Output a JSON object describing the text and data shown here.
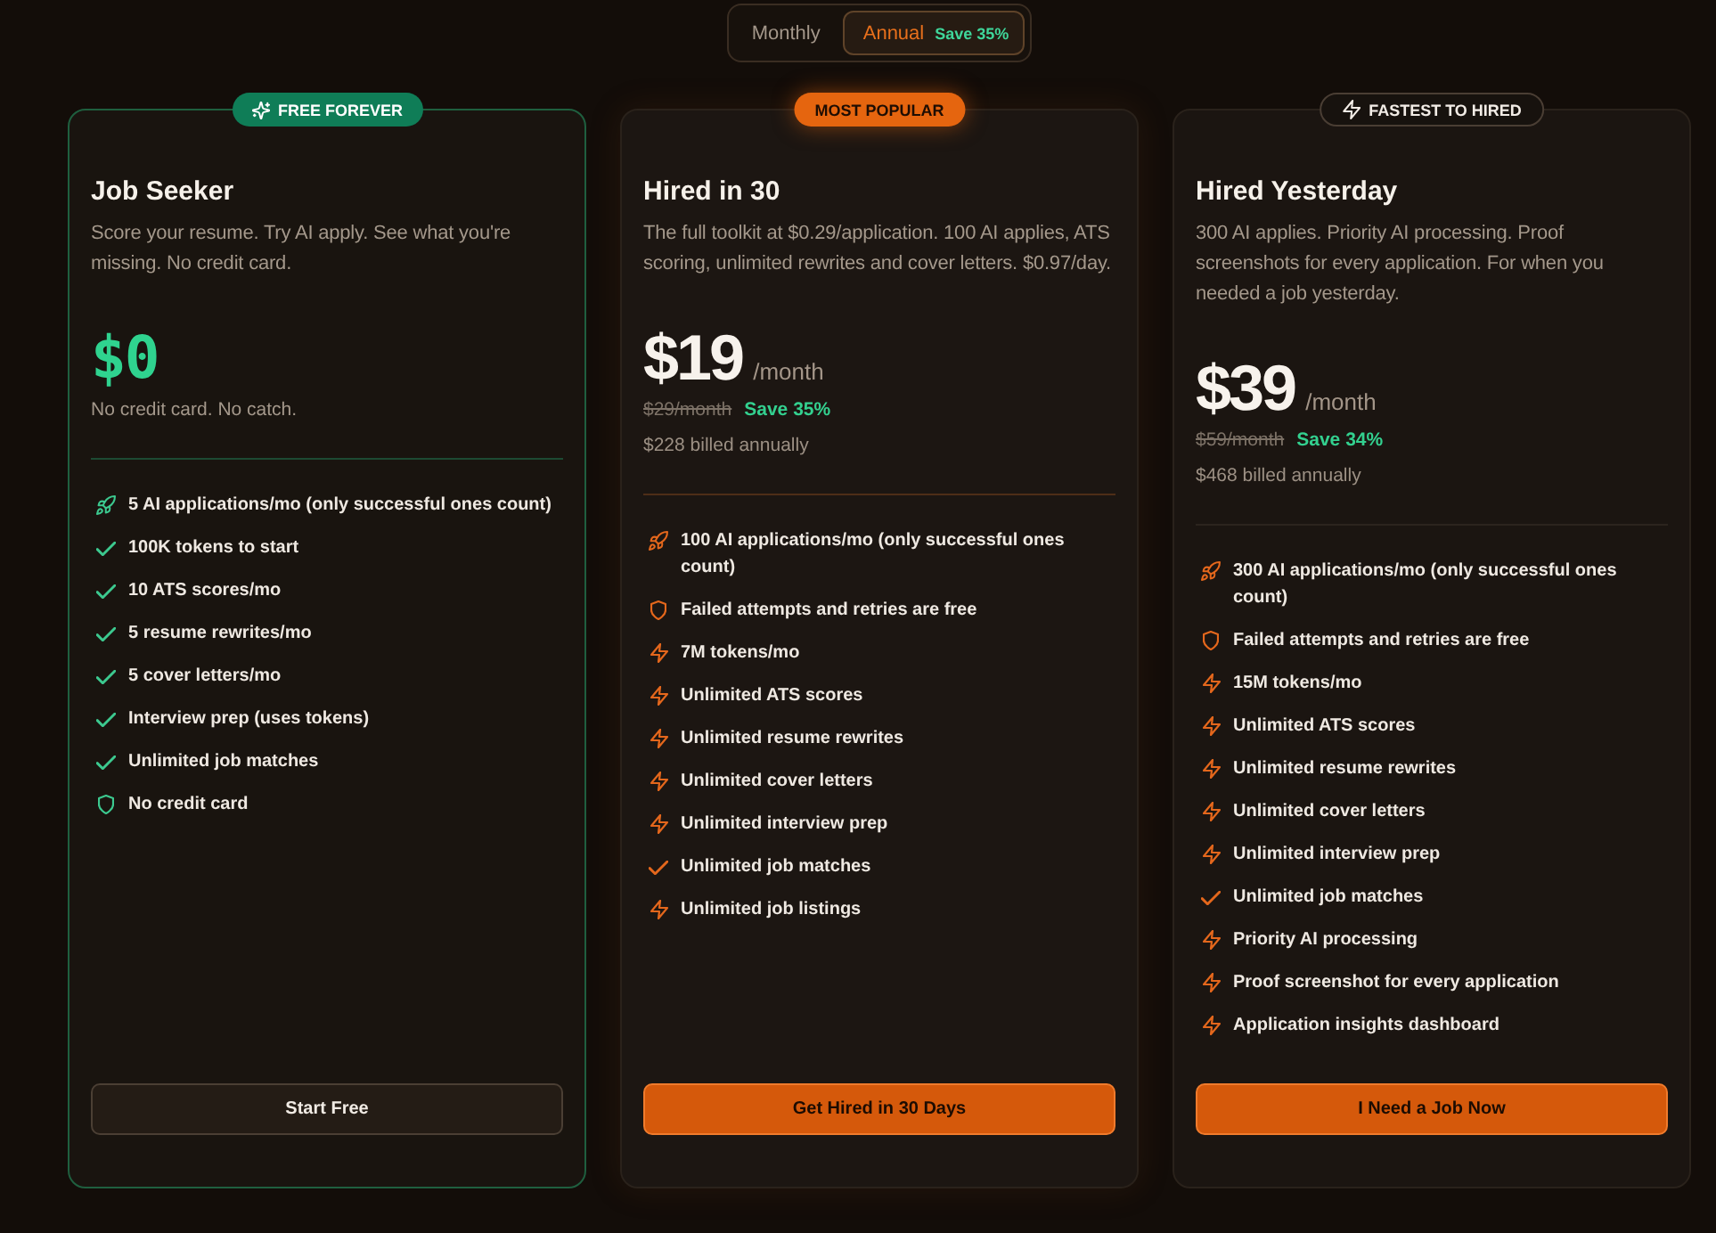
{
  "billing_toggle": {
    "options": [
      {
        "label": "Monthly",
        "selected": false
      },
      {
        "label": "Annual",
        "selected": true,
        "badge": "Save 35%"
      }
    ]
  },
  "plans": [
    {
      "kind": "free",
      "badge": "FREE FOREVER",
      "name": "Job Seeker",
      "description": "Score your resume. Try AI apply. See what you're missing. No credit card.",
      "price": "$0",
      "note": "No credit card. No catch.",
      "features": [
        {
          "kind": "applications",
          "text": "5 AI applications/mo (only successful ones count)"
        },
        {
          "kind": "included",
          "text": "100K tokens to start"
        },
        {
          "kind": "included",
          "text": "10 ATS scores/mo"
        },
        {
          "kind": "included",
          "text": "5 resume rewrites/mo"
        },
        {
          "kind": "included",
          "text": "5 cover letters/mo"
        },
        {
          "kind": "included",
          "text": "Interview prep (uses tokens)"
        },
        {
          "kind": "included",
          "text": "Unlimited job matches"
        },
        {
          "kind": "guarantee",
          "text": "No credit card"
        }
      ],
      "button": "Start Free"
    },
    {
      "kind": "popular",
      "badge": "MOST POPULAR",
      "name": "Hired in 30",
      "description": "The full toolkit at $0.29/application. 100 AI applies, ATS scoring, unlimited rewrites and cover letters. $0.97/day.",
      "price": "$19",
      "period": "/month",
      "original_price": "$29/month",
      "savings": "Save 35%",
      "billing": "$228 billed annually",
      "features": [
        {
          "kind": "applications",
          "text": "100 AI applications/mo (only successful ones count)"
        },
        {
          "kind": "guarantee",
          "text": "Failed attempts and retries are free"
        },
        {
          "kind": "boost",
          "text": "7M tokens/mo"
        },
        {
          "kind": "boost",
          "text": "Unlimited ATS scores"
        },
        {
          "kind": "boost",
          "text": "Unlimited resume rewrites"
        },
        {
          "kind": "boost",
          "text": "Unlimited cover letters"
        },
        {
          "kind": "boost",
          "text": "Unlimited interview prep"
        },
        {
          "kind": "included",
          "text": "Unlimited job matches"
        },
        {
          "kind": "boost",
          "text": "Unlimited job listings"
        }
      ],
      "button": "Get Hired in 30 Days"
    },
    {
      "kind": "premium",
      "badge": "FASTEST TO HIRED",
      "name": "Hired Yesterday",
      "description": "300 AI applies. Priority AI processing. Proof screenshots for every application. For when you needed a job yesterday.",
      "price": "$39",
      "period": "/month",
      "original_price": "$59/month",
      "savings": "Save 34%",
      "billing": "$468 billed annually",
      "features": [
        {
          "kind": "applications",
          "text": "300 AI applications/mo (only successful ones count)"
        },
        {
          "kind": "guarantee",
          "text": "Failed attempts and retries are free"
        },
        {
          "kind": "boost",
          "text": "15M tokens/mo"
        },
        {
          "kind": "boost",
          "text": "Unlimited ATS scores"
        },
        {
          "kind": "boost",
          "text": "Unlimited resume rewrites"
        },
        {
          "kind": "boost",
          "text": "Unlimited cover letters"
        },
        {
          "kind": "boost",
          "text": "Unlimited interview prep"
        },
        {
          "kind": "included",
          "text": "Unlimited job matches"
        },
        {
          "kind": "boost",
          "text": "Priority AI processing"
        },
        {
          "kind": "boost",
          "text": "Proof screenshot for every application"
        },
        {
          "kind": "boost",
          "text": "Application insights dashboard"
        }
      ],
      "button": "I Need a Job Now"
    }
  ]
}
